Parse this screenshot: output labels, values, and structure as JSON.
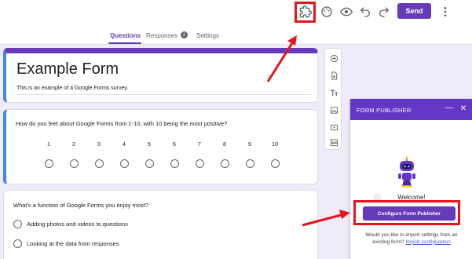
{
  "topbar": {
    "send_label": "Send",
    "icons": [
      "addon-puzzle-icon",
      "palette-icon",
      "preview-eye-icon",
      "undo-icon",
      "redo-icon",
      "more-vert-icon"
    ],
    "accent_color": "#673ab7",
    "highlight_color": "#e8141b"
  },
  "tabs": {
    "questions": "Questions",
    "responses": "Responses",
    "responses_count": "2",
    "settings": "Settings"
  },
  "form": {
    "title": "Example Form",
    "description": "This is an example of a Google Forms survey."
  },
  "question1": {
    "text": "How do you feel about Google Forms from 1-10, with 10 being the most positive?",
    "scale": [
      "1",
      "2",
      "3",
      "4",
      "5",
      "6",
      "7",
      "8",
      "9",
      "10"
    ]
  },
  "question2": {
    "text": "What's a function of Google Forms you enjoy most?",
    "options": [
      "Adding photos and videos to questions",
      "Looking at the data from responses"
    ]
  },
  "side_toolbar": {
    "icons": [
      "add-question-icon",
      "import-questions-icon",
      "add-title-icon",
      "add-image-icon",
      "add-video-icon",
      "add-section-icon"
    ]
  },
  "form_publisher": {
    "title": "FORM PUBLISHER",
    "minimize_glyph": "—",
    "close_glyph": "✕",
    "welcome": "Welcome!",
    "configure_button": "Configure Form Publisher",
    "import_prompt": "Would you like to import settings from an existing form?",
    "import_link": "Import configuration"
  }
}
